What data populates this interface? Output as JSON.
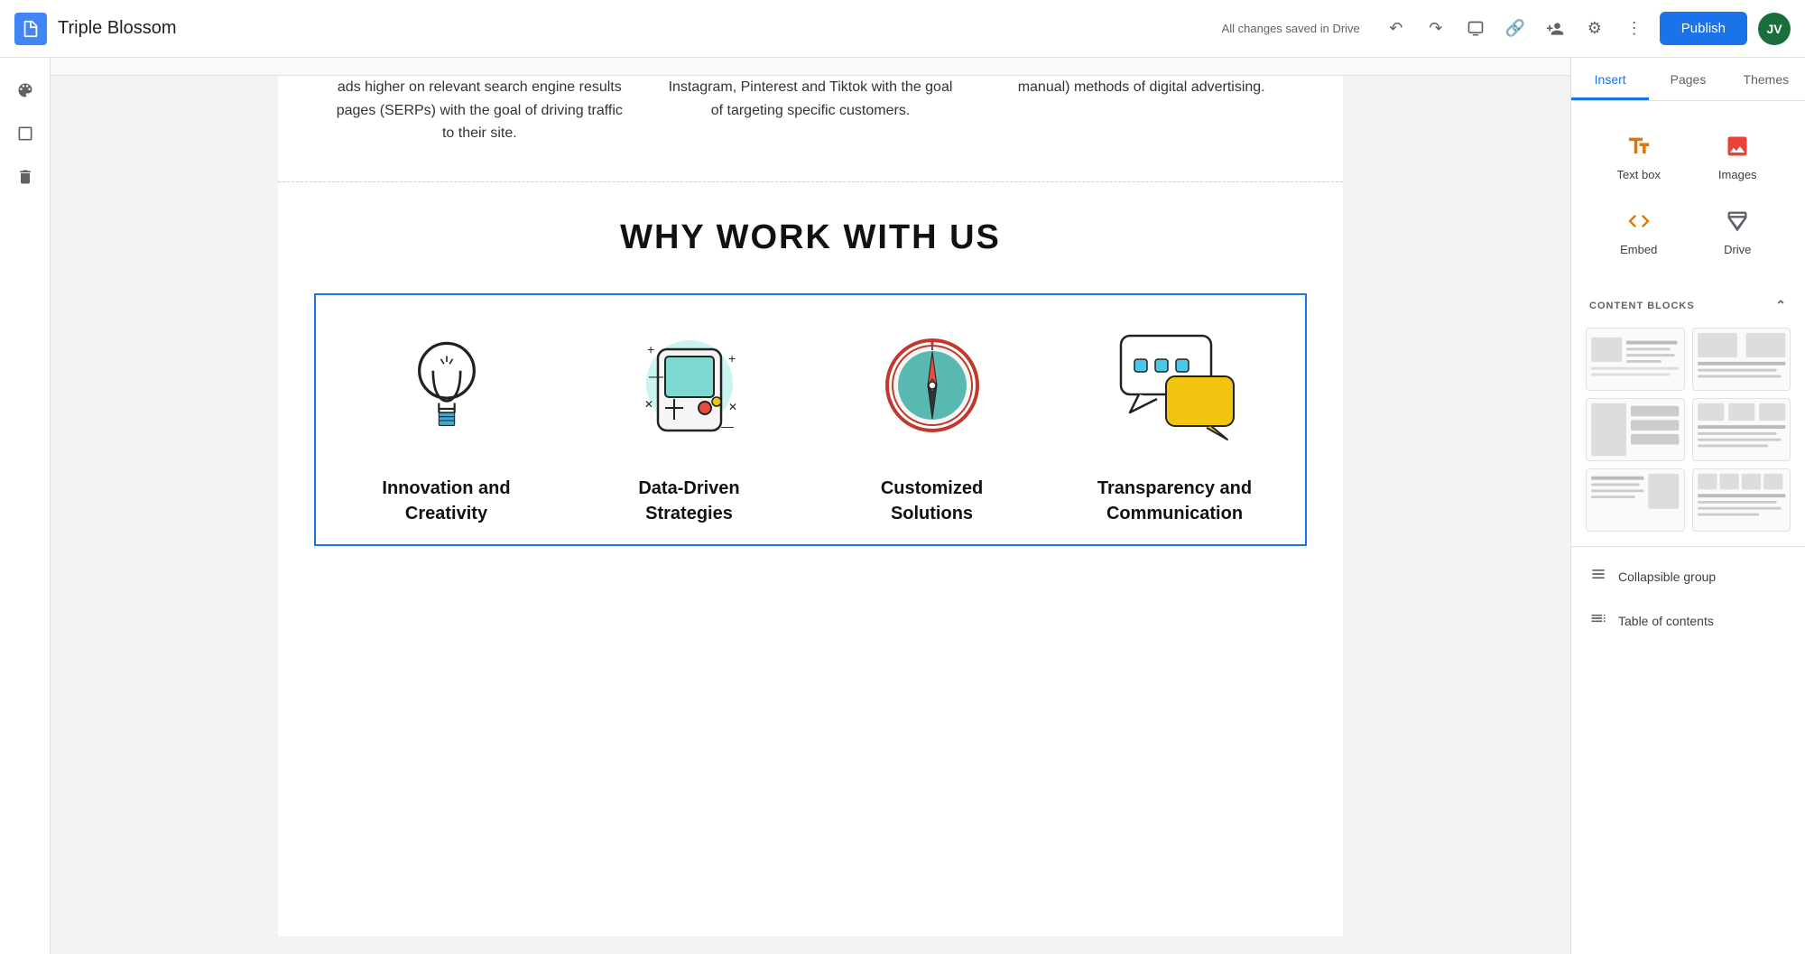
{
  "topbar": {
    "title": "Triple Blossom",
    "status": "All changes saved in Drive",
    "publish_label": "Publish",
    "avatar_initials": "JV"
  },
  "insert_panel": {
    "tabs": [
      "Insert",
      "Pages",
      "Themes"
    ],
    "active_tab": "Insert",
    "items": [
      {
        "id": "text-box",
        "label": "Text box",
        "icon": "TT",
        "color": "orange"
      },
      {
        "id": "images",
        "label": "Images",
        "icon": "🖼",
        "color": "red"
      },
      {
        "id": "embed",
        "label": "Embed",
        "icon": "<>",
        "color": "orange"
      },
      {
        "id": "drive",
        "label": "Drive",
        "icon": "△",
        "color": "gray"
      }
    ],
    "content_blocks_label": "CONTENT BLOCKS",
    "collapsible_group_label": "Collapsible group",
    "table_of_contents_label": "Table of contents"
  },
  "canvas": {
    "partial_columns": [
      "ads higher on relevant search engine results pages (SERPs) with the goal of driving traffic to their site.",
      "Instagram, Pinterest and Tiktok with the goal of targeting specific customers.",
      "manual) methods of digital advertising."
    ],
    "why_section_title": "WHY WORK WITH US",
    "block_items": [
      {
        "id": "innovation",
        "label": "Innovation and\nCreativity"
      },
      {
        "id": "data-driven",
        "label": "Data-Driven\nStrategies"
      },
      {
        "id": "customized",
        "label": "Customized\nSolutions"
      },
      {
        "id": "transparency",
        "label": "Transparency and\nCommunication"
      }
    ]
  }
}
